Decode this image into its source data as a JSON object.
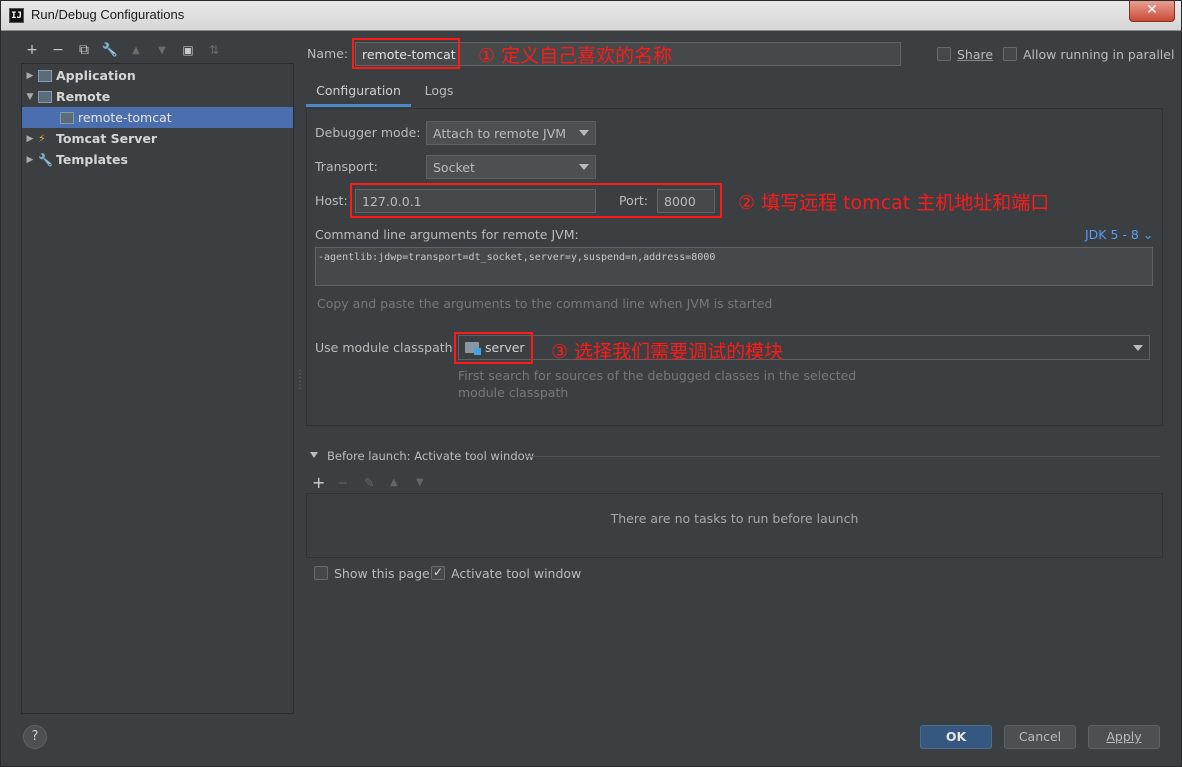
{
  "window": {
    "title": "Run/Debug Configurations",
    "close_glyph": "✕",
    "app_icon_glyph": "IJ"
  },
  "toolbar_left": [
    "+",
    "−",
    "⧉",
    "🔧",
    "▲",
    "▼",
    "▣",
    "⇅"
  ],
  "tree": {
    "items": [
      {
        "label": "Application",
        "expanded": false
      },
      {
        "label": "Remote",
        "expanded": true
      },
      {
        "label": "remote-tomcat",
        "selected": true
      },
      {
        "label": "Tomcat Server",
        "expanded": false
      },
      {
        "label": "Templates",
        "expanded": false
      }
    ]
  },
  "name_row": {
    "label": "Name:",
    "value": "remote-tomcat",
    "share_label": "Share",
    "parallel_label": "Allow running in parallel"
  },
  "tabs": [
    "Configuration",
    "Logs"
  ],
  "config": {
    "debugger_mode_label": "Debugger mode:",
    "debugger_mode_value": "Attach to remote JVM",
    "transport_label": "Transport:",
    "transport_value": "Socket",
    "host_label": "Host:",
    "host_value": "127.0.0.1",
    "port_label": "Port:",
    "port_value": "8000",
    "cmd_label": "Command line arguments for remote JVM:",
    "jdk_link": "JDK 5 - 8 ⌄",
    "cmd_value": "-agentlib:jdwp=transport=dt_socket,server=y,suspend=n,address=8000",
    "cmd_hint": "Copy and paste the arguments to the command line when JVM is started",
    "module_label": "Use module classpath:",
    "module_value": "server",
    "module_hint_1": "First search for sources of the debugged classes in the selected",
    "module_hint_2": "module classpath"
  },
  "before_launch": {
    "title": "Before launch: Activate tool window",
    "tools": [
      "+",
      "−",
      "✎",
      "▲",
      "▼"
    ],
    "empty_text": "There are no tasks to run before launch",
    "show_page_label": "Show this page",
    "activate_label": "Activate tool window"
  },
  "annotations": {
    "a1": "① 定义自己喜欢的名称",
    "a2": "② 填写远程 tomcat 主机地址和端口",
    "a3": "③ 选择我们需要调试的模块",
    "color": "#ff1a1a"
  },
  "buttons": {
    "help": "?",
    "ok": "OK",
    "cancel": "Cancel",
    "apply": "Apply"
  }
}
